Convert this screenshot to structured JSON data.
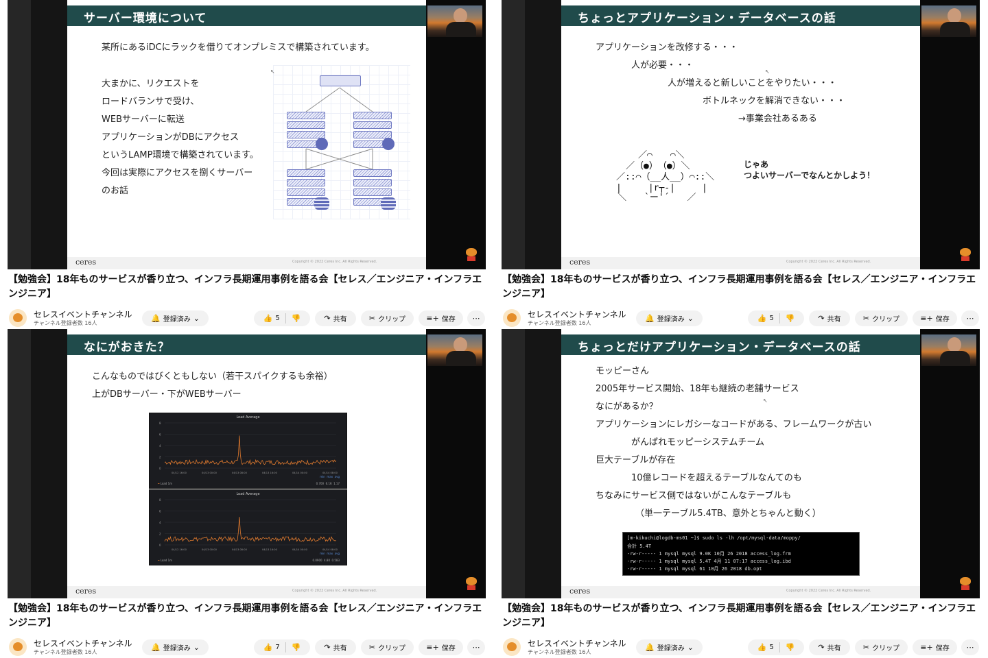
{
  "video_title": "【勉強会】18年ものサービスが香り立つ、インフラ長期運用事例を語る会【セレス／エンジニア・インフラエンジニア】",
  "channel": {
    "name": "セレスイベントチャンネル",
    "subscribers": "チャンネル登録者数 16人",
    "subscribed_label": "登録済み"
  },
  "actions": {
    "share": "共有",
    "clip": "クリップ",
    "save": "保存"
  },
  "slide_footer": {
    "logo": "ceres",
    "copyright": "Copyright © 2022 Ceres Inc. All Rights Reserved."
  },
  "panels": [
    {
      "likes": "5",
      "slide": {
        "title": "サーバー環境について",
        "lines": [
          "某所にあるiDCにラックを借りてオンプレミスで構築されています。",
          "大まかに、リクエストを",
          "ロードバランサで受け、",
          "WEBサーバーに転送",
          "アプリケーションがDBにアクセス",
          "というLAMP環境で構築されています。",
          "今回は実際にアクセスを捌くサーバー",
          "のお話"
        ]
      }
    },
    {
      "likes": "5",
      "slide": {
        "title": "ちょっとアプリケーション・データベースの話",
        "lines": [
          "アプリケーションを改修する・・・",
          "人が必要・・・",
          "人が増えると新しいことをやりたい・・・",
          "ボトルネックを解消できない・・・",
          "→事業会社あるある"
        ],
        "callout": [
          "じゃあ",
          "つよいサーバーでなんとかしよう！"
        ]
      }
    },
    {
      "likes": "7",
      "slide": {
        "title": "なにがおきた？",
        "lines": [
          "こんなものではびくともしない（若干スパイクするも余裕）",
          "上がDBサーバー・下がWEBサーバー"
        ],
        "graph_title": "Load Average",
        "graph_legend": "Load 1m",
        "graph_headers": [
          "min",
          "max",
          "avg"
        ],
        "graph_top_values": [
          "0.700",
          "6.16",
          "1.17"
        ],
        "graph_bottom_values": [
          "0.0900",
          "4.80",
          "0.583"
        ],
        "x_ticks": [
          "04/12 16:00",
          "04/13 00:00",
          "04/13 08:00",
          "04/13 16:00",
          "04/14 00:00",
          "04/14 08:00"
        ],
        "y_ticks": [
          "8",
          "6",
          "4",
          "2",
          "0"
        ]
      }
    },
    {
      "likes": "5",
      "slide": {
        "title": "ちょっとだけアプリケーション・データベースの話",
        "lines": [
          "モッピーさん",
          "2005年サービス開始、18年も継続の老舗サービス",
          "なにがあるか？",
          "アプリケーションにレガシーなコードがある、フレームワークが古い",
          "がんばれモッピーシステムチーム",
          "巨大テーブルが存在",
          "10億レコードを超えるテーブルなんてのも",
          "ちなみにサービス側ではないがこんなテーブルも",
          "（単一テーブル5.4TB、意外とちゃんと動く）"
        ],
        "terminal": [
          "[m-kikuchi@logdb-ms01 ~]$ sudo ls -lh /opt/mysql-data/moppy/",
          "合計 5.4T",
          "-rw-r-----  1 mysql mysql 9.0K 10月  26   2018 access_log.frm",
          "-rw-r-----  1 mysql mysql 5.4T  4月  11 07:17 access_log.ibd",
          "-rw-r-----  1 mysql mysql   61 10月  26   2018 db.opt"
        ]
      }
    }
  ]
}
